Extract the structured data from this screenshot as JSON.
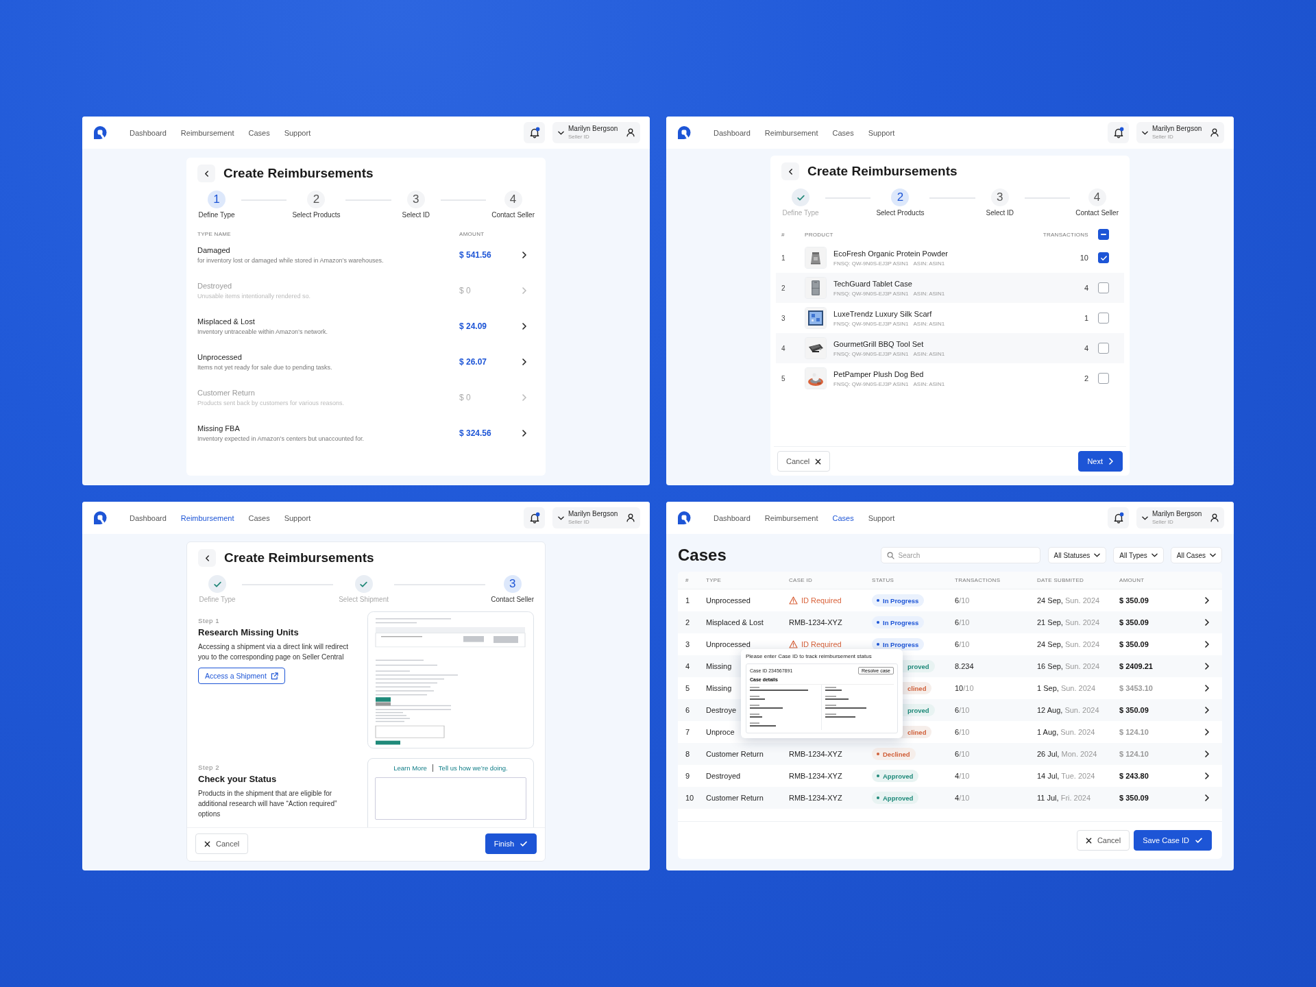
{
  "panels": [
    {
      "kind": "types",
      "nav": [
        {
          "label": "Dashboard",
          "selected": false
        },
        {
          "label": "Reimbursement",
          "selected": false
        },
        {
          "label": "Cases",
          "selected": false
        },
        {
          "label": "Support",
          "selected": false
        }
      ],
      "user": {
        "name": "Marilyn Bergson",
        "role": "Seller ID"
      },
      "title": "Create Reimbursements",
      "steps": [
        {
          "number": "1",
          "label": "Define Type",
          "done": false,
          "selected": true
        },
        {
          "number": "2",
          "label": "Select Products",
          "done": false,
          "selected": false
        },
        {
          "number": "3",
          "label": "Select ID",
          "done": false,
          "selected": false
        },
        {
          "number": "4",
          "label": "Contact Seller",
          "done": false,
          "selected": false
        }
      ],
      "columns": [
        "TYPE NAME",
        "AMOUNT"
      ],
      "rows": [
        {
          "name": "Damaged",
          "description": "for inventory lost or damaged while stored in Amazon’s warehouses.",
          "amount": "$ 541.56",
          "disabled": false
        },
        {
          "name": "Destroyed",
          "description": "Unusable items intentionally rendered so.",
          "amount": "$ 0",
          "disabled": true
        },
        {
          "name": "Misplaced & Lost",
          "description": "Inventory untraceable within Amazon’s network.",
          "amount": "$ 24.09",
          "disabled": false
        },
        {
          "name": "Unprocessed",
          "description": "Items not yet ready for sale due to pending tasks.",
          "amount": "$ 26.07",
          "disabled": false
        },
        {
          "name": "Customer Return",
          "description": "Products sent back by customers for various reasons.",
          "amount": "$ 0",
          "disabled": true
        },
        {
          "name": "Missing FBA",
          "description": "Inventory expected in Amazon’s centers but unaccounted for.",
          "amount": "$ 324.56",
          "disabled": false
        }
      ]
    },
    {
      "kind": "products",
      "nav": [
        {
          "label": "Dashboard",
          "selected": false
        },
        {
          "label": "Reimbursement",
          "selected": false
        },
        {
          "label": "Cases",
          "selected": false
        },
        {
          "label": "Support",
          "selected": false
        }
      ],
      "user": {
        "name": "Marilyn Bergson",
        "role": "Seller ID"
      },
      "title": "Create Reimbursements",
      "steps": [
        {
          "label": "Define Type",
          "done": true,
          "selected": false
        },
        {
          "number": "2",
          "label": "Select Products",
          "done": false,
          "selected": true
        },
        {
          "number": "3",
          "label": "Select ID",
          "done": false,
          "selected": false
        },
        {
          "number": "4",
          "label": "Contact Seller",
          "done": false,
          "selected": false
        }
      ],
      "columns": [
        "#",
        "PRODUCT",
        "TRANSACTIONS"
      ],
      "select_all": {
        "partial": true
      },
      "rows": [
        {
          "number": "1",
          "name": "EcoFresh Organic Protein Powder",
          "fnsq": "FNSQ: QW-9N0S-EJ3P ASIN1",
          "asin": "ASIN: ASIN1",
          "transactions": "10",
          "checked": true
        },
        {
          "number": "2",
          "name": "TechGuard Tablet Case",
          "fnsq": "FNSQ: QW-9N0S-EJ3P ASIN1",
          "asin": "ASIN: ASIN1",
          "transactions": "4",
          "checked": false
        },
        {
          "number": "3",
          "name": "LuxeTrendz Luxury Silk Scarf",
          "fnsq": "FNSQ: QW-9N0S-EJ3P ASIN1",
          "asin": "ASIN: ASIN1",
          "transactions": "1",
          "checked": false
        },
        {
          "number": "4",
          "name": "GourmetGrill BBQ Tool Set",
          "fnsq": "FNSQ: QW-9N0S-EJ3P ASIN1",
          "asin": "ASIN: ASIN1",
          "transactions": "4",
          "checked": false
        },
        {
          "number": "5",
          "name": "PetPamper Plush Dog Bed",
          "fnsq": "FNSQ: QW-9N0S-EJ3P ASIN1",
          "asin": "ASIN: ASIN1",
          "transactions": "2",
          "checked": false
        }
      ],
      "actions": [
        {
          "label": "Cancel",
          "kind": "dismiss"
        },
        {
          "label": "Next",
          "kind": "next"
        }
      ]
    },
    {
      "kind": "guide",
      "nav": [
        {
          "label": "Dashboard",
          "selected": false
        },
        {
          "label": "Reimbursement",
          "selected": true
        },
        {
          "label": "Cases",
          "selected": false
        },
        {
          "label": "Support",
          "selected": false
        }
      ],
      "user": {
        "name": "Marilyn Bergson",
        "role": "Seller ID"
      },
      "title": "Create Reimbursements",
      "steps": [
        {
          "label": "Define Type",
          "done": true,
          "selected": false
        },
        {
          "label": "Select Shipment",
          "done": true,
          "selected": false
        },
        {
          "number": "3",
          "label": "Contact Seller",
          "done": false,
          "selected": true
        }
      ],
      "sections": [
        {
          "step": "Step 1",
          "title": "Research Missing Units",
          "body": "Accessing a shipment via a direct link will redirect you to the corresponding page on Seller Central",
          "button": "Access a Shipment",
          "kind": "document"
        },
        {
          "step": "Step 2",
          "title": "Check your Status",
          "body": "Products in the shipment that are eligible for additional research will have “Action required” options",
          "links": [
            "Learn More",
            "Tell us how we’re doing."
          ],
          "kind": "links"
        }
      ],
      "actions": [
        {
          "label": "Cancel",
          "kind": "cancel"
        },
        {
          "label": "Finish",
          "kind": "confirm"
        }
      ]
    },
    {
      "kind": "cases",
      "nav": [
        {
          "label": "Dashboard",
          "selected": false
        },
        {
          "label": "Reimbursement",
          "selected": false
        },
        {
          "label": "Cases",
          "selected": true
        },
        {
          "label": "Support",
          "selected": false
        }
      ],
      "user": {
        "name": "Marilyn Bergson",
        "role": "Seller ID"
      },
      "title": "Cases",
      "search": {
        "placeholder": "Search"
      },
      "filters": [
        "All Statuses",
        "All Types",
        "All Cases"
      ],
      "columns": [
        "#",
        "TYPE",
        "CASE ID",
        "STATUS",
        "TRANSACTIONS",
        "DATE SUBMITED",
        "AMOUNT"
      ],
      "rows": [
        {
          "number": "1",
          "type": "Unprocessed",
          "case_id": "ID Required",
          "case_id_alert": true,
          "status": {
            "label": "In Progress",
            "kind": "progress"
          },
          "covered": false,
          "transactions": "6",
          "transactions_total": "/10",
          "date": "24 Sep,",
          "date_detail": "Sun. 2024",
          "amount": "$ 350.09",
          "muted": false
        },
        {
          "number": "2",
          "type": "Misplaced & Lost",
          "case_id": "RMB-1234-XYZ",
          "case_id_alert": false,
          "status": {
            "label": "In Progress",
            "kind": "progress"
          },
          "covered": false,
          "transactions": "6",
          "transactions_total": "/10",
          "date": "21 Sep,",
          "date_detail": "Sun. 2024",
          "amount": "$ 350.09",
          "muted": false
        },
        {
          "number": "3",
          "type": "Unprocessed",
          "case_id": "ID Required",
          "case_id_alert": true,
          "status": {
            "label": "In Progress",
            "kind": "progress"
          },
          "covered": false,
          "transactions": "6",
          "transactions_total": "/10",
          "date": "24 Sep,",
          "date_detail": "Sun. 2024",
          "amount": "$ 350.09",
          "muted": false
        },
        {
          "number": "4",
          "type": "Missing",
          "status": {
            "label": "proved",
            "kind": "approved"
          },
          "covered": true,
          "transactions": "8.234",
          "date": "16 Sep,",
          "date_detail": "Sun. 2024",
          "amount": "$ 2409.21",
          "muted": false
        },
        {
          "number": "5",
          "type": "Missing",
          "status": {
            "label": "clined",
            "kind": "declined"
          },
          "covered": true,
          "transactions": "10",
          "transactions_total": "/10",
          "date": "1 Sep,",
          "date_detail": "Sun. 2024",
          "amount": "$ 3453.10",
          "muted": true
        },
        {
          "number": "6",
          "type": "Destroye",
          "status": {
            "label": "proved",
            "kind": "approved"
          },
          "covered": true,
          "transactions": "6",
          "transactions_total": "/10",
          "date": "12 Aug,",
          "date_detail": "Sun. 2024",
          "amount": "$ 350.09",
          "muted": false
        },
        {
          "number": "7",
          "type": "Unproce",
          "status": {
            "label": "clined",
            "kind": "declined"
          },
          "covered": true,
          "transactions": "6",
          "transactions_total": "/10",
          "date": "1 Aug,",
          "date_detail": "Sun. 2024",
          "amount": "$ 124.10",
          "muted": true
        },
        {
          "number": "8",
          "type": "Customer Return",
          "case_id": "RMB-1234-XYZ",
          "case_id_alert": false,
          "status": {
            "label": "Declined",
            "kind": "declined"
          },
          "covered": false,
          "transactions": "6",
          "transactions_total": "/10",
          "date": "26 Jul,",
          "date_detail": "Mon. 2024",
          "amount": "$ 124.10",
          "muted": true
        },
        {
          "number": "9",
          "type": "Destroyed",
          "case_id": "RMB-1234-XYZ",
          "case_id_alert": false,
          "status": {
            "label": "Approved",
            "kind": "approved"
          },
          "covered": false,
          "transactions": "4",
          "transactions_total": "/10",
          "date": "14 Jul,",
          "date_detail": "Tue. 2024",
          "amount": "$ 243.80",
          "muted": false
        },
        {
          "number": "10",
          "type": "Customer Return",
          "case_id": "RMB-1234-XYZ",
          "case_id_alert": false,
          "status": {
            "label": "Approved",
            "kind": "approved"
          },
          "covered": false,
          "transactions": "4",
          "transactions_total": "/10",
          "date": "11 Jul,",
          "date_detail": "Fri. 2024",
          "amount": "$ 350.09",
          "muted": false
        }
      ],
      "popup": {
        "title": "Please enter Case ID to track reimbursement status",
        "case_id": "Case ID 234567891",
        "action": "Resolve case",
        "section": "Case details"
      },
      "actions": [
        {
          "label": "Cancel",
          "kind": "cancel"
        },
        {
          "label": "Save Case ID",
          "kind": "confirm"
        }
      ]
    }
  ]
}
